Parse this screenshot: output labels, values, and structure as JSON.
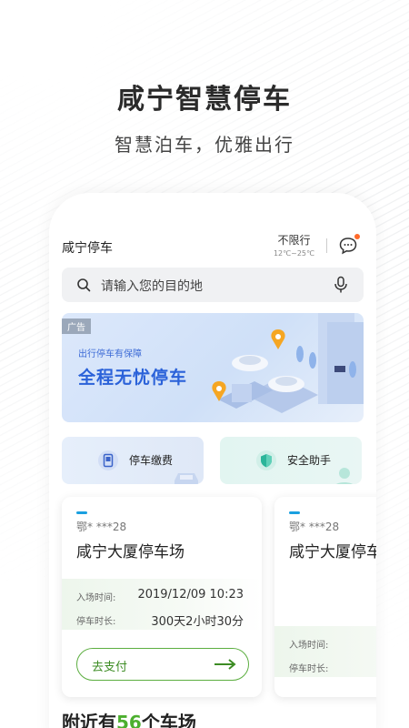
{
  "hero": {
    "title": "咸宁智慧停车",
    "subtitle": "智慧泊车，优雅出行"
  },
  "header": {
    "app_name": "咸宁停车",
    "restriction": "不限行",
    "temperature": "12℃~25℃",
    "message_icon": "chat-bubble-icon"
  },
  "search": {
    "placeholder": "请输入您的目的地",
    "icon": "search-icon",
    "voice_icon": "microphone-icon"
  },
  "banner": {
    "ad_tag": "广告",
    "subtitle": "出行停车有保障",
    "title": "全程无忧停车"
  },
  "quick_actions": [
    {
      "label": "停车缴费",
      "icon": "parking-payment-icon"
    },
    {
      "label": "安全助手",
      "icon": "shield-icon"
    }
  ],
  "parking_cards": [
    {
      "plate": "鄂* ***28",
      "lot_name": "咸宁大厦停车场",
      "entry_label": "入场时间:",
      "entry_time": "2019/12/09 10:23",
      "duration_label": "停车时长:",
      "duration": "300天2小时30分",
      "pay_label": "去支付"
    },
    {
      "plate": "鄂* ***28",
      "lot_name": "咸宁大厦停车场",
      "entry_label": "入场时间:",
      "duration_label": "停车时长:"
    }
  ],
  "nearby": {
    "prefix": "附近有",
    "count": "56",
    "suffix": "个车场"
  },
  "colors": {
    "accent_green": "#4caf2e",
    "accent_blue": "#2b62d9",
    "badge_orange": "#ff6a2a"
  }
}
